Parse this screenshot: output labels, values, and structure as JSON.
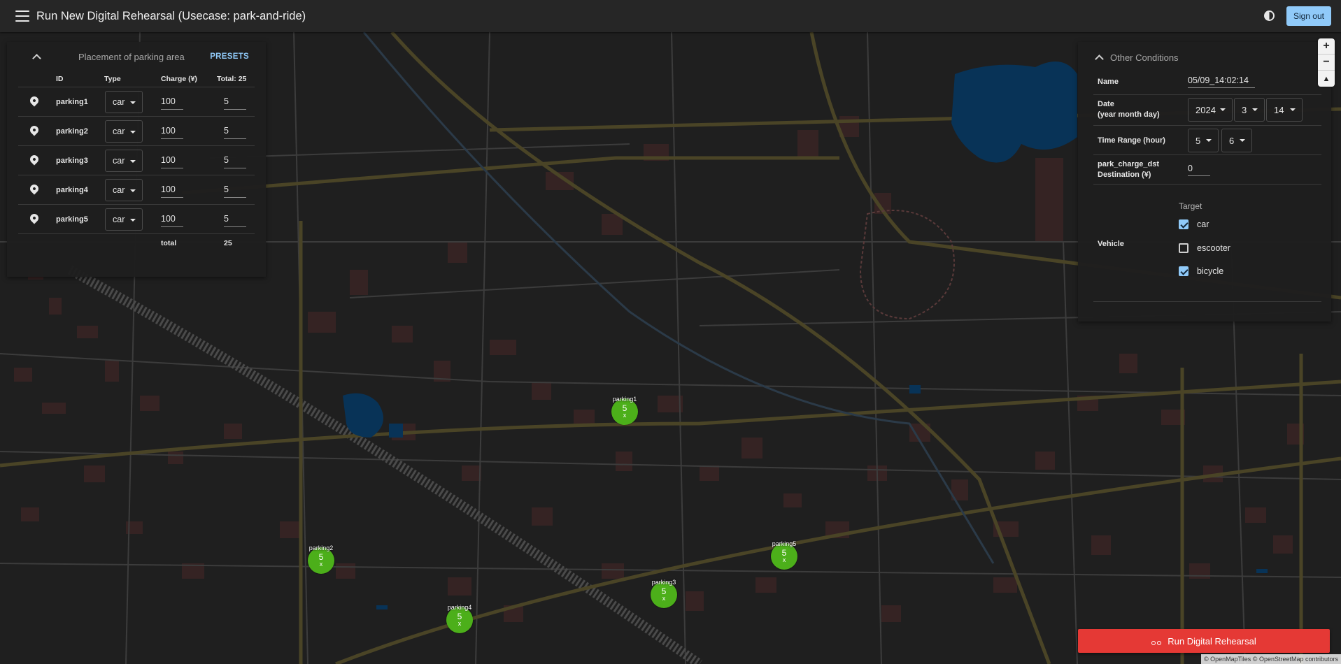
{
  "app": {
    "title": "Run New Digital Rehearsal (Usecase: park-and-ride)",
    "signout": "Sign out"
  },
  "placement": {
    "title": "Placement of parking area",
    "presets": "PRESETS",
    "col_id": "ID",
    "col_type": "Type",
    "col_charge": "Charge (¥)",
    "col_total": "Total: 25",
    "rows": [
      {
        "id": "parking1",
        "type": "car",
        "charge": "100",
        "count": "5"
      },
      {
        "id": "parking2",
        "type": "car",
        "charge": "100",
        "count": "5"
      },
      {
        "id": "parking3",
        "type": "car",
        "charge": "100",
        "count": "5"
      },
      {
        "id": "parking4",
        "type": "car",
        "charge": "100",
        "count": "5"
      },
      {
        "id": "parking5",
        "type": "car",
        "charge": "100",
        "count": "5"
      }
    ],
    "total_label": "total",
    "total_value": "25"
  },
  "conditions": {
    "title": "Other Conditions",
    "name_label": "Name",
    "name_value": "05/09_14:02:14",
    "date_label_1": "Date",
    "date_label_2": "(year month day)",
    "year": "2024",
    "month": "3",
    "day": "14",
    "time_label": "Time Range (hour)",
    "time_from": "5",
    "time_to": "6",
    "charge_label_1": "park_charge_dst",
    "charge_label_2": "Destination (¥)",
    "charge_value": "0",
    "vehicle_label": "Vehicle",
    "target_label": "Target",
    "vehicles": [
      {
        "label": "car",
        "checked": true
      },
      {
        "label": "escooter",
        "checked": false
      },
      {
        "label": "bicycle",
        "checked": true
      }
    ]
  },
  "map": {
    "markers": [
      {
        "name": "parking1",
        "count": "5",
        "x_label": "x"
      },
      {
        "name": "parking2",
        "count": "5",
        "x_label": "x"
      },
      {
        "name": "parking3",
        "count": "5",
        "x_label": "x"
      },
      {
        "name": "parking4",
        "count": "5",
        "x_label": "x"
      },
      {
        "name": "parking5",
        "count": "5",
        "x_label": "x"
      }
    ],
    "zoom_in": "+",
    "zoom_out": "−",
    "compass": "▲",
    "attribution": "© OpenMapTiles © OpenStreetMap contributors"
  },
  "run_button": "Run Digital Rehearsal",
  "colors": {
    "marker": "#4caf1a",
    "run": "#e53935",
    "accent": "#90caf9"
  }
}
